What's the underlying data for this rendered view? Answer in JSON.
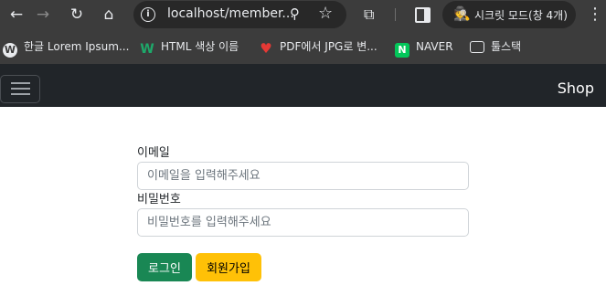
{
  "browser": {
    "url": "localhost/member...",
    "incognito_label": "시크릿 모드(창 4개)",
    "icons": [
      "back-icon",
      "forward-icon",
      "reload-icon",
      "home-icon",
      "info-icon",
      "zoom-icon",
      "star-icon",
      "extensions-icon",
      "side-panel-icon",
      "incognito-icon",
      "more-icon"
    ]
  },
  "bookmarks": [
    {
      "label": "한글 Lorem Ipsum...",
      "icon": "wordpress-icon"
    },
    {
      "label": "HTML 색상 이름",
      "icon": "w-logo-icon"
    },
    {
      "label": "PDF에서 JPG로 변...",
      "icon": "heart-icon"
    },
    {
      "label": "NAVER",
      "icon": "naver-icon"
    },
    {
      "label": "툴스택",
      "icon": "folder-icon"
    }
  ],
  "navbar": {
    "brand": "Shop",
    "toggler_icon": "hamburger-icon"
  },
  "form": {
    "email_label": "이메일",
    "email_placeholder": "이메일을 입력해주세요",
    "password_label": "비밀번호",
    "password_placeholder": "비밀번호를 입력해주세요",
    "login_button": "로그인",
    "signup_button": "회원가입"
  },
  "colors": {
    "navbar_bg": "#212529",
    "login_btn": "#198754",
    "signup_btn": "#ffc107",
    "chrome_bg": "#3c3c3c"
  }
}
